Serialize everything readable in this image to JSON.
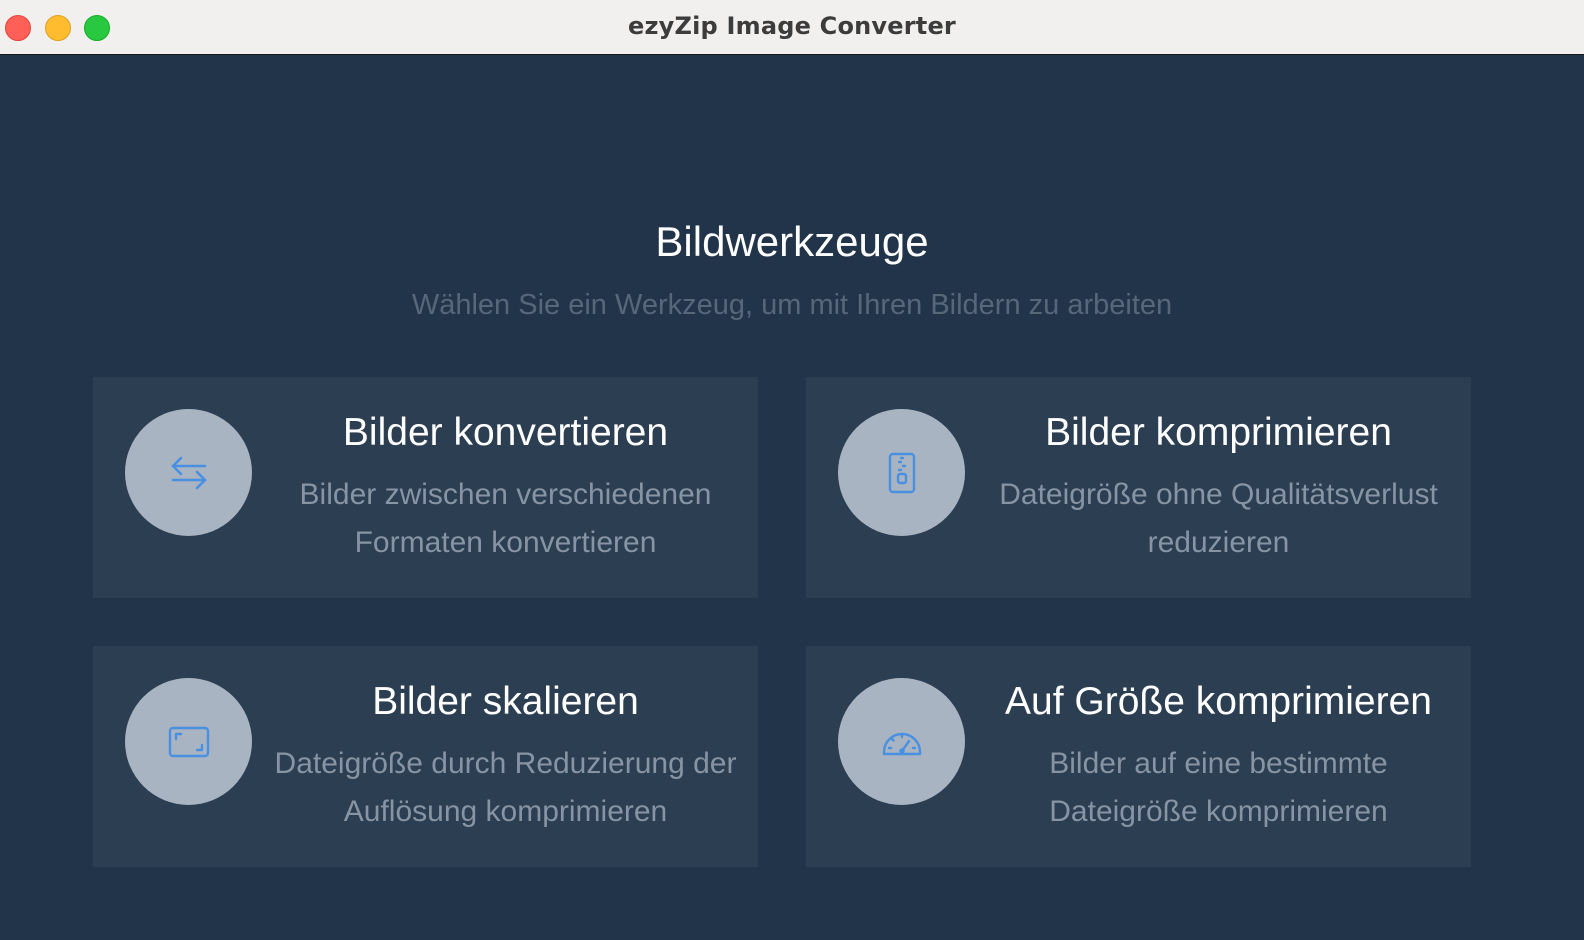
{
  "window": {
    "title": "ezyZip Image Converter"
  },
  "header": {
    "title": "Bildwerkzeuge",
    "subtitle": "Wählen Sie ein Werkzeug, um mit Ihren Bildern zu arbeiten"
  },
  "tools": [
    {
      "title": "Bilder konvertieren",
      "description": "Bilder zwischen verschiedenen Formaten konvertieren",
      "icon": "arrows-exchange-icon"
    },
    {
      "title": "Bilder komprimieren",
      "description": "Dateigröße ohne Qualitätsverlust reduzieren",
      "icon": "zip-file-icon"
    },
    {
      "title": "Bilder skalieren",
      "description": "Dateigröße durch Reduzierung der Auflösung komprimieren",
      "icon": "resize-frame-icon"
    },
    {
      "title": "Auf Größe komprimieren",
      "description": "Bilder auf eine bestimmte Dateigröße komprimieren",
      "icon": "gauge-icon"
    }
  ],
  "colors": {
    "background": "#213449",
    "card": "#2c3e52",
    "icon_circle": "#a8b4c2",
    "icon_accent": "#4a90e2",
    "title_text": "#ffffff",
    "muted_text": "#8694a4"
  }
}
